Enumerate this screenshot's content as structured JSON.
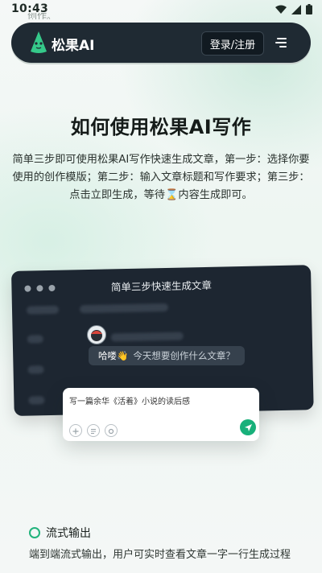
{
  "status_bar": {
    "time": "10:43"
  },
  "ghost_text": "创作。",
  "navbar": {
    "logo_text": "松果AI",
    "login_label": "登录/注册"
  },
  "hero": {
    "title": "如何使用松果AI写作",
    "description": "简单三步即可使用松果AI写作快速生成文章，第一步：选择你要使用的创作模版；第二步：输入文章标题和写作要求；第三步：点击立即生成，等待⌛内容生成即可。"
  },
  "demo": {
    "card_title": "简单三步快速生成文章",
    "greeting": "哈喽👋",
    "question": "今天想要创作什么文章？",
    "input_text": "写一篇余华《活着》小说的读后感"
  },
  "feature": {
    "title": "流式输出",
    "description": "端到端流式输出，用户可实时查看文章一字一行生成过程"
  },
  "colors": {
    "navbar_bg": "#1f2a33",
    "accent_green": "#22b37c",
    "dark_card_bg": "#1d2631"
  }
}
